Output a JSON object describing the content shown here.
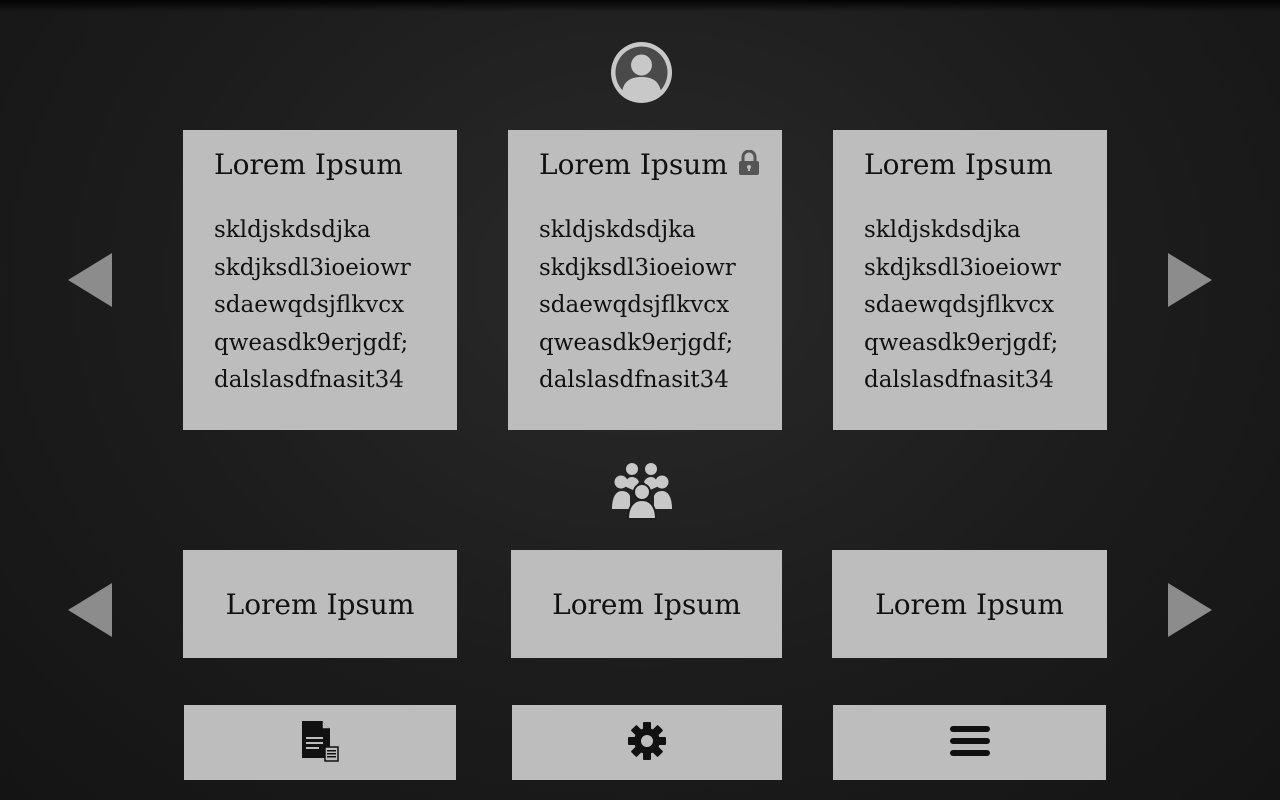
{
  "profile": {
    "icon": "user-avatar-icon"
  },
  "featured_cards": [
    {
      "title": "Lorem Ipsum",
      "locked": false,
      "lines": [
        "skldjskdsdjka",
        "skdjksdl3ioeiowr",
        "sdaewqdsjflkvcx",
        "qweasdk9erjgdf;",
        "dalslasdfnasit34"
      ]
    },
    {
      "title": "Lorem Ipsum",
      "locked": true,
      "lines": [
        "skldjskdsdjka",
        "skdjksdl3ioeiowr",
        "sdaewqdsjflkvcx",
        "qweasdk9erjgdf;",
        "dalslasdfnasit34"
      ]
    },
    {
      "title": "Lorem Ipsum",
      "locked": false,
      "lines": [
        "skldjskdsdjka",
        "skdjksdl3ioeiowr",
        "sdaewqdsjflkvcx",
        "qweasdk9erjgdf;",
        "dalslasdfnasit34"
      ]
    }
  ],
  "group": {
    "icon": "group-users-icon"
  },
  "group_cards": [
    {
      "title": "Lorem Ipsum"
    },
    {
      "title": "Lorem Ipsum"
    },
    {
      "title": "Lorem Ipsum"
    }
  ],
  "toolbar": [
    {
      "icon": "document-icon"
    },
    {
      "icon": "gear-icon"
    },
    {
      "icon": "hamburger-menu-icon"
    }
  ],
  "colors": {
    "background": "#1c1c1c",
    "card": "#bdbdbd",
    "arrow": "#8c8c8c",
    "icon_light": "#c8c8c8",
    "text": "#111111"
  }
}
